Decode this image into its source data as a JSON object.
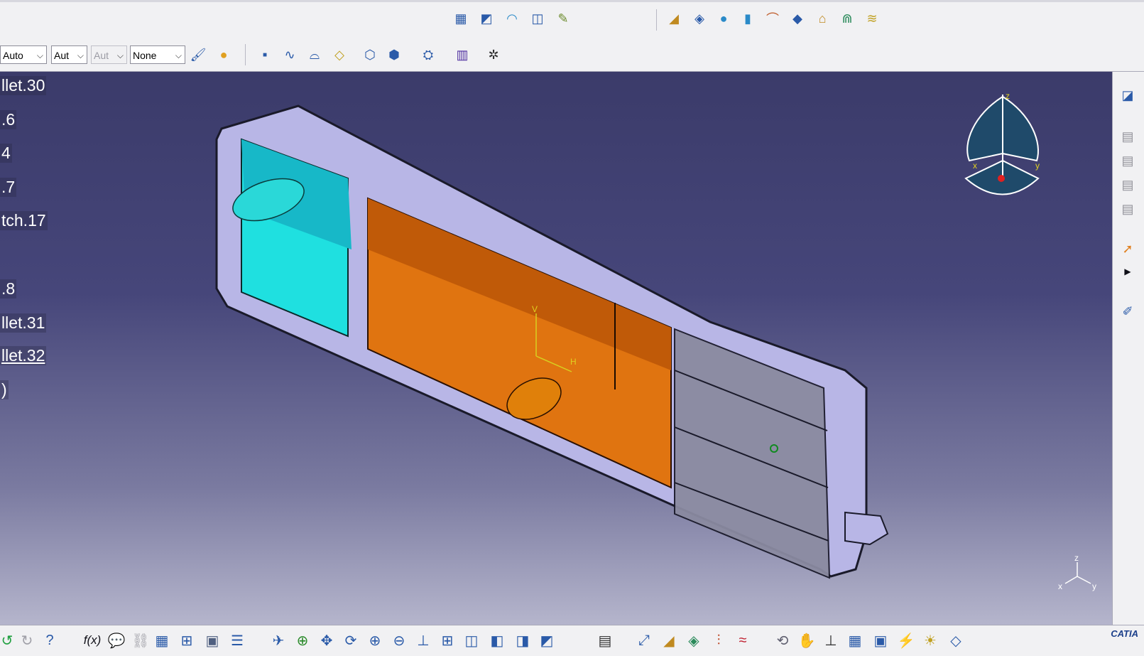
{
  "toolbar": {
    "combo_color": "Auto",
    "combo_linetype": "Aut",
    "combo_thickness": "Aut",
    "combo_layer": "None"
  },
  "tree": {
    "items": [
      {
        "label": "llet.30"
      },
      {
        "label": ".6"
      },
      {
        "label": "4"
      },
      {
        "label": ".7"
      },
      {
        "label": "tch.17"
      },
      {
        "label": ".8"
      },
      {
        "label": "llet.31"
      },
      {
        "label": "llet.32"
      },
      {
        "label": ")"
      }
    ]
  },
  "compass": {
    "x": "x",
    "y": "y",
    "z": "z"
  },
  "axis_indicator": {
    "x": "x",
    "y": "y",
    "z": "z"
  },
  "sketch_axes": {
    "v": "V",
    "h": "H"
  },
  "bottom": {
    "formula_label": "f(x)",
    "brand": "CATIA"
  },
  "colors": {
    "viewport_top": "#3b3b6a",
    "part_body": "#b8b6e6",
    "cyan_face": "#1fe0e0",
    "orange_face": "#e07410",
    "accent_blue": "#1b3f8a"
  }
}
